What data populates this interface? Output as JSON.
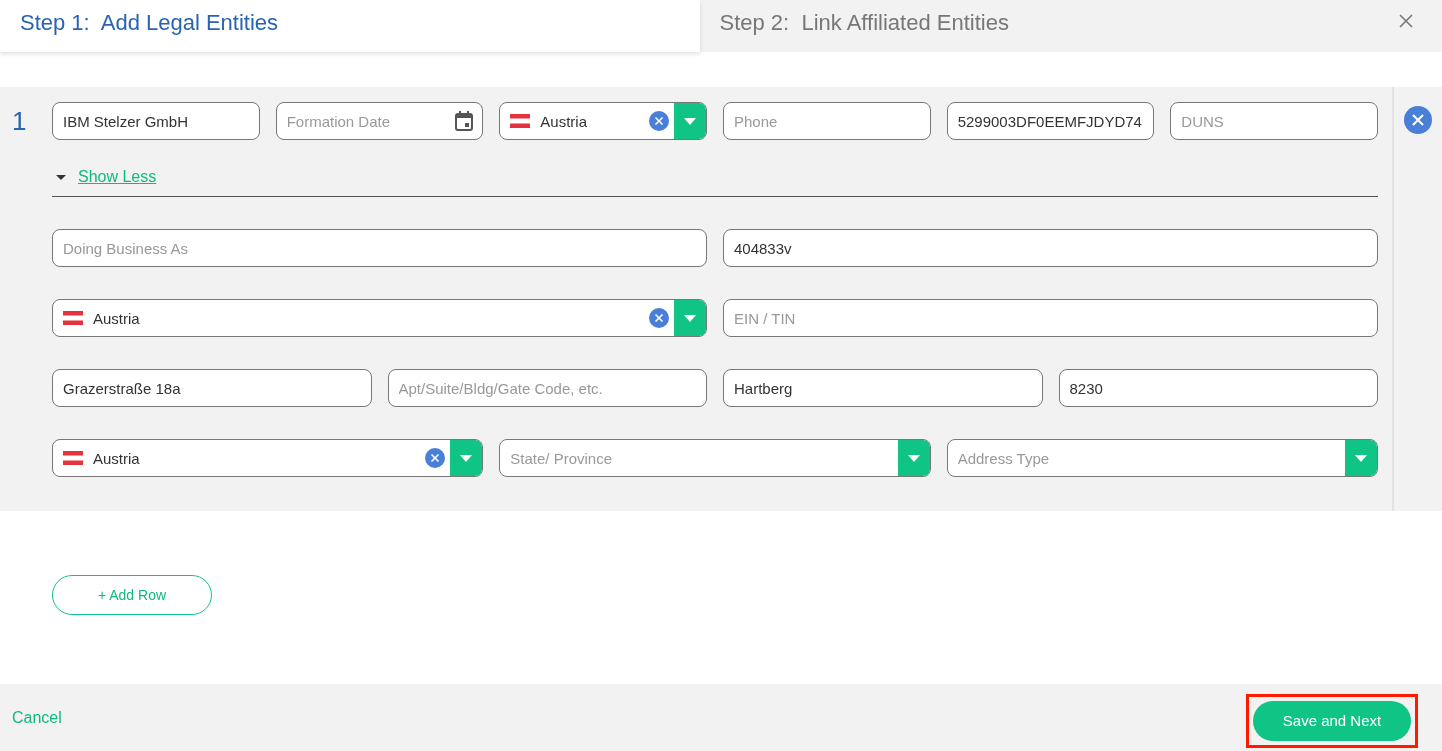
{
  "tabs": [
    {
      "label": "Step 1:  Add Legal Entities",
      "selected": true
    },
    {
      "label": "Step 2:  Link Affiliated Entities",
      "selected": false
    }
  ],
  "entities": [
    {
      "number": "1",
      "fields": [
        {
          "kind": "text",
          "value": "IBM Stelzer GmbH"
        },
        {
          "kind": "date",
          "placeholder": "Formation Date"
        },
        {
          "kind": "select",
          "value": "Austria"
        },
        {
          "kind": "text",
          "placeholder": "Phone"
        },
        {
          "kind": "text",
          "value": "5299003DF0EEMFJDYD74"
        },
        {
          "kind": "text",
          "placeholder": "DUNS"
        }
      ],
      "toggle": {
        "label": "Show Less",
        "expanded": true
      },
      "detail_rows": [
        [
          {
            "kind": "text",
            "placeholder": "Doing Business As"
          },
          {
            "kind": "text",
            "value": "404833v"
          }
        ],
        [
          {
            "kind": "select",
            "value": "Austria"
          },
          {
            "kind": "text",
            "placeholder": "EIN / TIN"
          }
        ],
        [
          {
            "kind": "text",
            "value": "Grazerstraße 18a"
          },
          {
            "kind": "text",
            "placeholder": "Apt/Suite/Bldg/Gate Code, etc."
          },
          {
            "kind": "text",
            "value": "Hartberg"
          },
          {
            "kind": "text",
            "value": "8230"
          }
        ],
        [
          {
            "kind": "select",
            "value": "Austria"
          },
          {
            "kind": "select",
            "placeholder": "State/ Province"
          },
          {
            "kind": "select",
            "placeholder": "Address Type"
          }
        ]
      ]
    }
  ],
  "add_row": "+ Add Row",
  "footer": {
    "cancel": "Cancel",
    "primary": "Save and Next",
    "primary_highlighted": true
  }
}
